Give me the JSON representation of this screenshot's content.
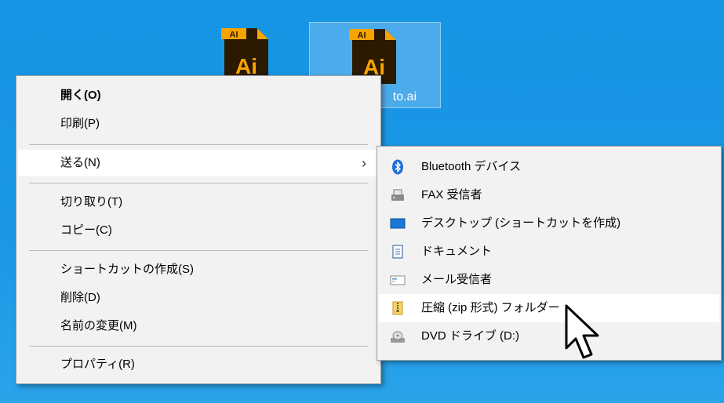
{
  "desktop": {
    "icons": [
      {
        "name": "",
        "badge": "AI",
        "mark": "Ai"
      },
      {
        "name": "to.ai",
        "badge": "AI",
        "mark": "Ai"
      }
    ]
  },
  "context_menu": {
    "items": [
      {
        "label": "開く(O)",
        "bold": true
      },
      {
        "label": "印刷(P)"
      },
      {
        "label": "送る(N)",
        "submenu": true
      },
      {
        "label": "切り取り(T)"
      },
      {
        "label": "コピー(C)"
      },
      {
        "label": "ショートカットの作成(S)"
      },
      {
        "label": "削除(D)"
      },
      {
        "label": "名前の変更(M)"
      },
      {
        "label": "プロパティ(R)"
      }
    ]
  },
  "send_to_menu": {
    "items": [
      {
        "label": "Bluetooth デバイス",
        "icon": "bluetooth-icon"
      },
      {
        "label": "FAX 受信者",
        "icon": "fax-icon"
      },
      {
        "label": "デスクトップ (ショートカットを作成)",
        "icon": "desktop-icon"
      },
      {
        "label": "ドキュメント",
        "icon": "document-icon"
      },
      {
        "label": "メール受信者",
        "icon": "mail-icon"
      },
      {
        "label": "圧縮 (zip 形式) フォルダー",
        "icon": "zip-folder-icon"
      },
      {
        "label": "DVD ドライブ (D:)",
        "icon": "dvd-drive-icon"
      }
    ]
  },
  "colors": {
    "desktop_bg": "#1695e4",
    "ai_orange": "#f7a400",
    "ai_dark": "#2b1a00",
    "menu_bg": "#f2f2f2",
    "hover_bg": "#ffffff"
  }
}
